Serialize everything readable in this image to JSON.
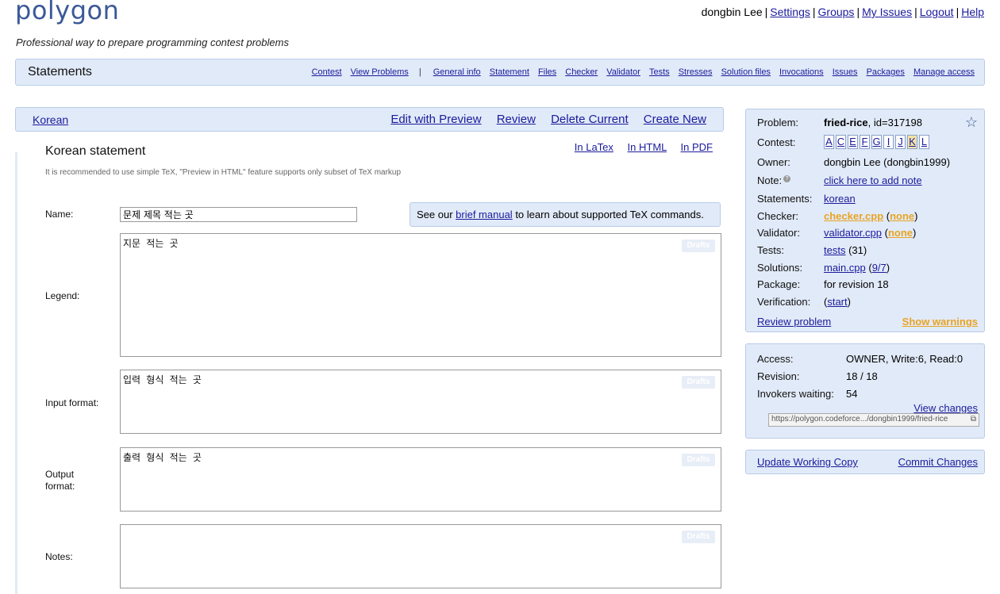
{
  "header": {
    "logo": "polygon",
    "tagline": "Professional way to prepare programming contest problems",
    "user": "dongbin Lee",
    "user_links": [
      "Settings",
      "Groups",
      "My Issues",
      "Logout",
      "Help"
    ]
  },
  "navbar": {
    "title": "Statements",
    "left_links": [
      "Contest",
      "View Problems"
    ],
    "links": [
      "General info",
      "Statement",
      "Files",
      "Checker",
      "Validator",
      "Tests",
      "Stresses",
      "Solution files",
      "Invocations",
      "Issues",
      "Packages",
      "Manage access"
    ]
  },
  "langbar": {
    "language": "Korean",
    "actions": [
      "Edit with Preview",
      "Review",
      "Delete Current",
      "Create New"
    ]
  },
  "statement": {
    "title": "Korean statement",
    "formats": [
      "In LaTex",
      "In HTML",
      "In PDF"
    ],
    "hint": "It is recommended to use simple TeX, \"Preview in HTML\" feature supports only subset of TeX markup",
    "name_label": "Name:",
    "name_value": "문제 제목 적는 곳",
    "manual_pre": "See our ",
    "manual_link": "brief manual",
    "manual_post": " to learn about supported TeX commands.",
    "legend_label": "Legend:",
    "legend_value": "지문 적는 곳",
    "input_label": "Input format:",
    "input_value": "입력 형식 적는 곳",
    "output_label": "Output format:",
    "output_value": "출력 형식 적는 곳",
    "notes_label": "Notes:",
    "notes_value": "",
    "drafts_label": "Drafts"
  },
  "problem_panel": {
    "problem_label": "Problem:",
    "problem_name": "fried-rice",
    "problem_id": ", id=317198",
    "contest_label": "Contest:",
    "contest_letters": [
      "A",
      "C",
      "E",
      "F",
      "G",
      "I",
      "J",
      "K",
      "L"
    ],
    "active_letter": "K",
    "owner_label": "Owner:",
    "owner_value": "dongbin Lee (dongbin1999)",
    "note_label": "Note:",
    "note_link": "click here to add note",
    "statements_label": "Statements:",
    "statements_value": "korean",
    "checker_label": "Checker:",
    "checker_value": "checker.cpp",
    "checker_extra": "none",
    "validator_label": "Validator:",
    "validator_value": "validator.cpp",
    "validator_extra": "none",
    "tests_label": "Tests:",
    "tests_link": "tests",
    "tests_count": " (31)",
    "solutions_label": "Solutions:",
    "solutions_link": "main.cpp",
    "solutions_extra": "9/7",
    "package_label": "Package:",
    "package_value": "for revision 18",
    "verification_label": "Verification:",
    "verification_link": "start",
    "review_link": "Review problem",
    "warnings_link": "Show warnings"
  },
  "access_panel": {
    "access_label": "Access:",
    "access_value": "OWNER, Write:6, Read:0",
    "revision_label": "Revision:",
    "revision_value": "18 / 18",
    "invokers_label": "Invokers waiting:",
    "invokers_value": "54",
    "view_changes": "View changes",
    "url": "https://polygon.codeforce.../dongbin1999/fried-rice"
  },
  "commit_panel": {
    "update": "Update Working Copy",
    "commit": "Commit Changes"
  },
  "colors": {
    "panel_bg": "#e1eaf8",
    "panel_border": "#b9cbe8",
    "link": "#1b1b9c",
    "warning": "#e8a424"
  }
}
